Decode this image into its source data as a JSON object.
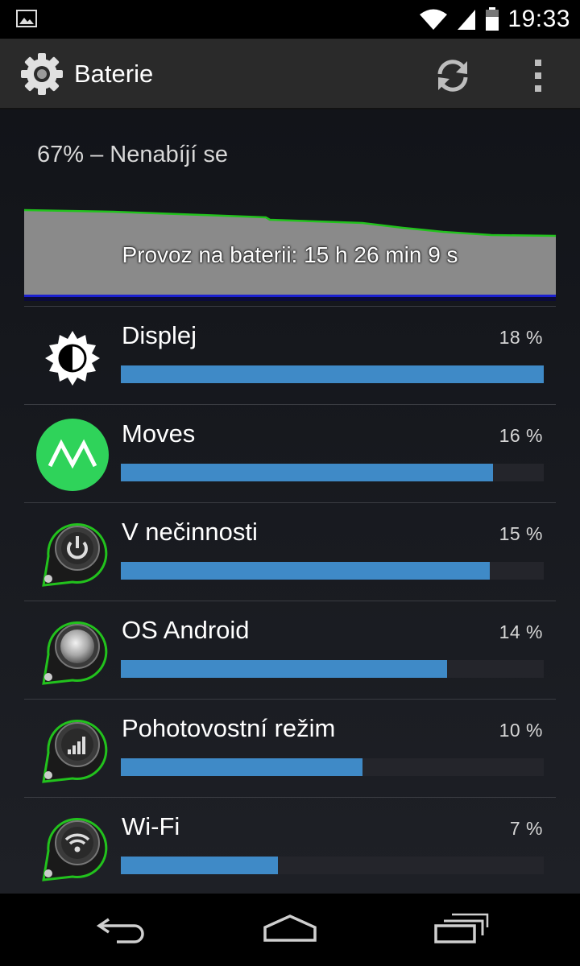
{
  "status_bar": {
    "time": "19:33",
    "icons": [
      "image-notification-icon",
      "wifi-icon",
      "signal-icon",
      "battery-icon"
    ]
  },
  "action_bar": {
    "title": "Baterie",
    "icons": [
      "gear-icon",
      "refresh-icon",
      "overflow-menu-icon"
    ]
  },
  "battery": {
    "status": "67% – Nenabíjí se",
    "graph_label": "Provoz na baterii: 15 h 26 min 9 s",
    "colors": {
      "graph_fill": "#8a8a8a",
      "graph_line": "#22c21d",
      "graph_baseline": "#1a1fd0"
    }
  },
  "usage": [
    {
      "label": "Displej",
      "percent_text": "18 %",
      "fraction": 1.0,
      "icon": "brightness-icon"
    },
    {
      "label": "Moves",
      "percent_text": "16 %",
      "fraction": 0.88,
      "icon": "moves-app-icon"
    },
    {
      "label": "V nečinnosti",
      "percent_text": "15 %",
      "fraction": 0.872,
      "icon": "power-icon"
    },
    {
      "label": "OS Android",
      "percent_text": "14 %",
      "fraction": 0.771,
      "icon": "android-os-icon"
    },
    {
      "label": "Pohotovostní režim",
      "percent_text": "10 %",
      "fraction": 0.571,
      "icon": "standby-signal-icon"
    },
    {
      "label": "Wi-Fi",
      "percent_text": "7 %",
      "fraction": 0.371,
      "icon": "wifi-usage-icon"
    }
  ],
  "colors": {
    "bar_fill": "#3f8ac7",
    "bar_track": "#24252b",
    "accent_green": "#22c21d"
  },
  "nav_bar": {
    "buttons": [
      "back-icon",
      "home-icon",
      "recent-apps-icon"
    ]
  }
}
